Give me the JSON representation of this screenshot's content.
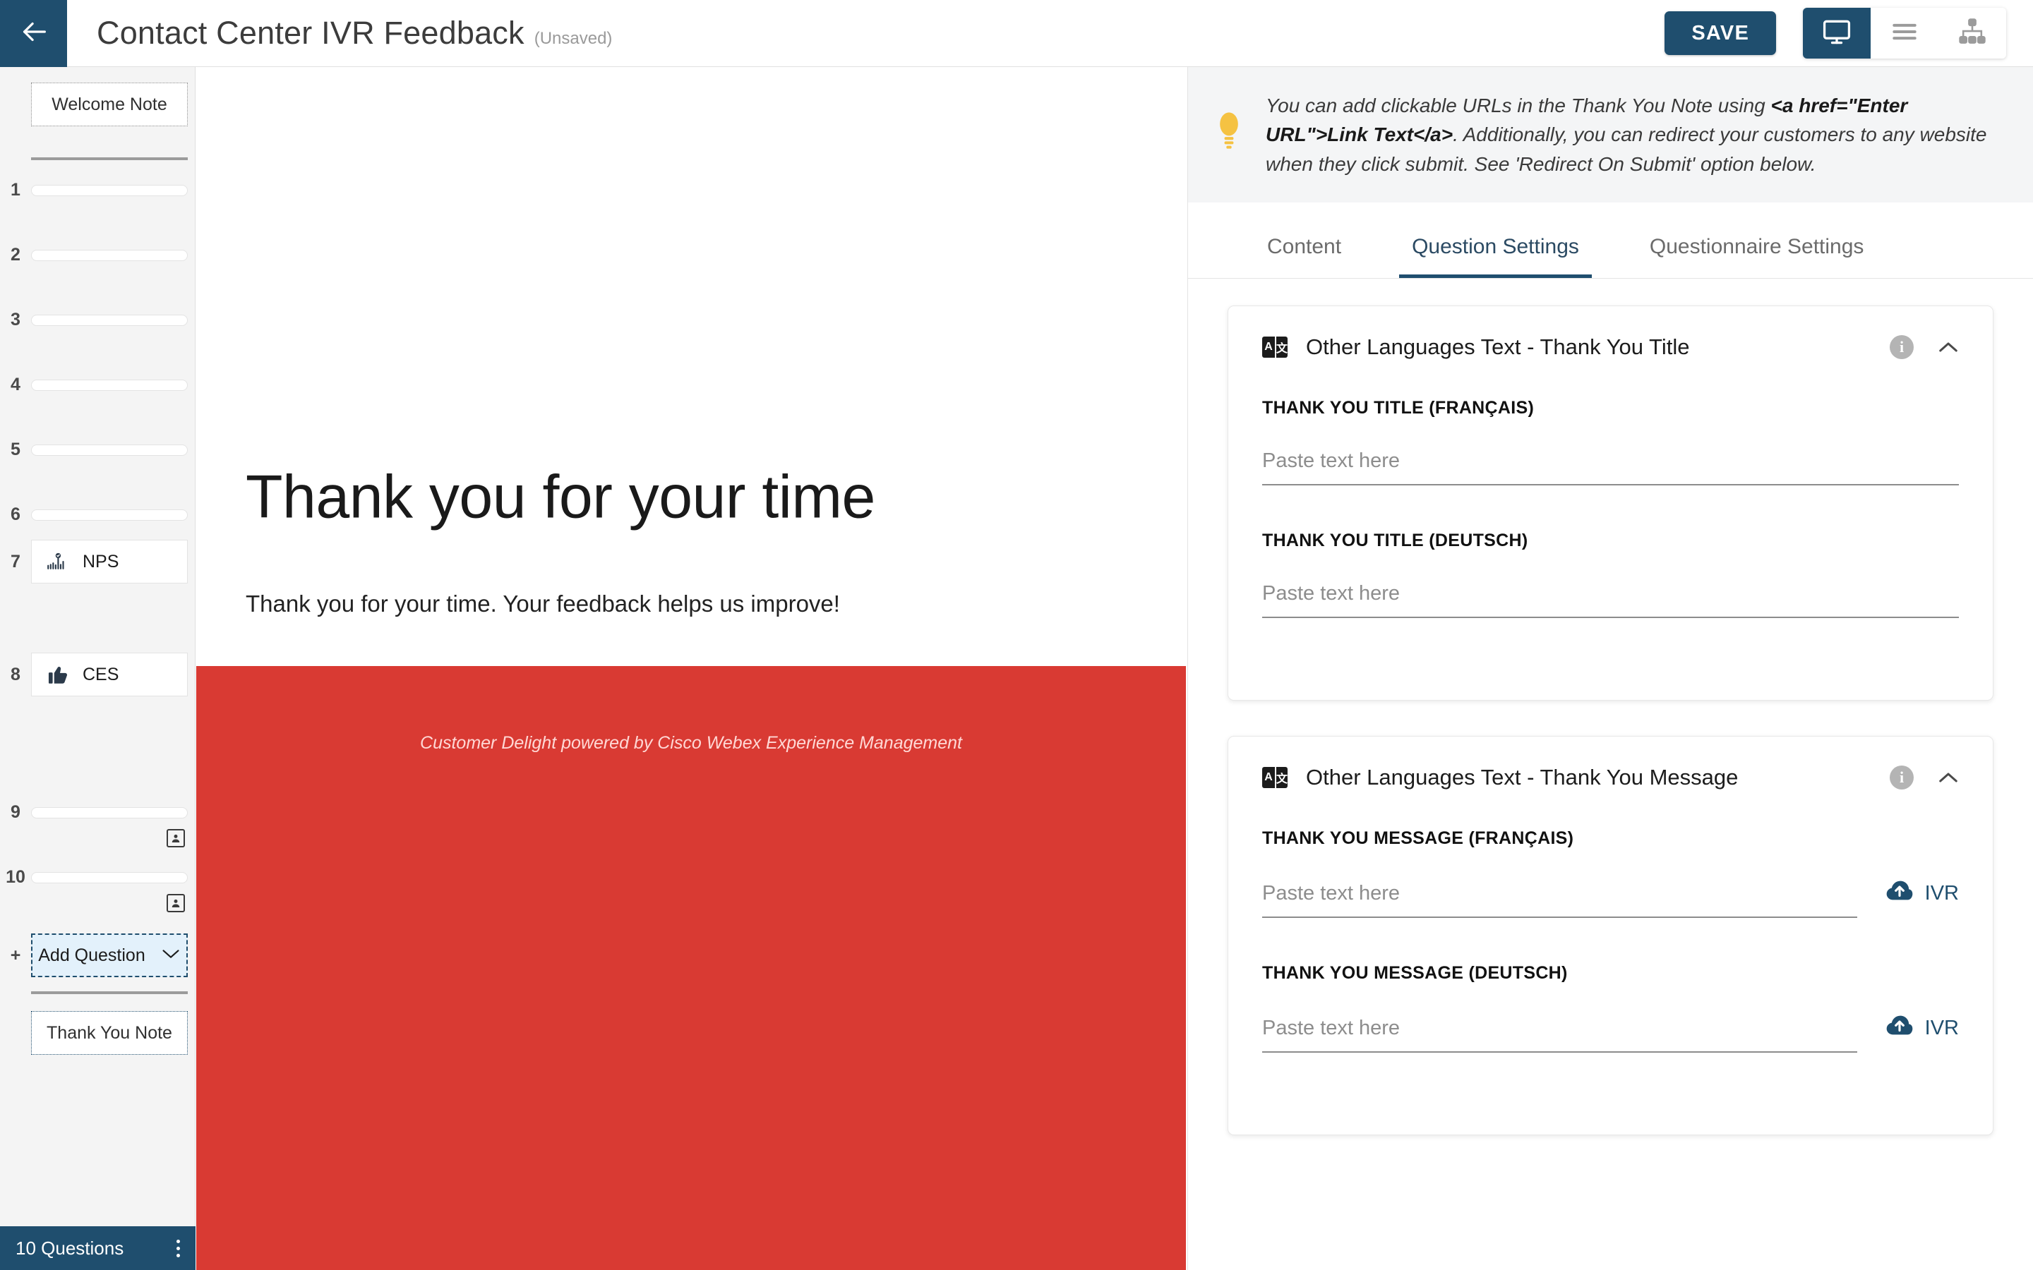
{
  "header": {
    "back_icon": "arrow-left-icon",
    "title": "Contact Center IVR Feedback",
    "unsaved_label": "(Unsaved)",
    "save_label": "SAVE",
    "view_buttons": [
      {
        "name": "preview-desktop",
        "icon": "monitor-icon",
        "active": true
      },
      {
        "name": "list-view",
        "icon": "hamburger-icon",
        "active": false
      },
      {
        "name": "flow-view",
        "icon": "sitemap-icon",
        "active": false
      }
    ]
  },
  "sidebar": {
    "welcome_note_label": "Welcome Note",
    "thank_you_note_label": "Thank You Note",
    "add_question_label": "Add Question",
    "add_question_prefix": "+",
    "questions": [
      {
        "number": "1",
        "type": "bar",
        "label": ""
      },
      {
        "number": "2",
        "type": "bar",
        "label": ""
      },
      {
        "number": "3",
        "type": "bar",
        "label": ""
      },
      {
        "number": "4",
        "type": "bar",
        "label": ""
      },
      {
        "number": "5",
        "type": "bar",
        "label": ""
      },
      {
        "number": "6",
        "type": "bar",
        "label": ""
      },
      {
        "number": "7",
        "type": "card",
        "label": "NPS",
        "icon": "nps-gauge-icon"
      },
      {
        "number": "8",
        "type": "card",
        "label": "CES",
        "icon": "thumbs-up-icon"
      },
      {
        "number": "9",
        "type": "bar",
        "label": "",
        "badge": "contact-card-icon"
      },
      {
        "number": "10",
        "type": "bar",
        "label": "",
        "badge": "contact-card-icon"
      }
    ],
    "status": {
      "count_label": "10 Questions",
      "menu_icon": "vertical-dots-icon"
    }
  },
  "canvas": {
    "thank_you_title": "Thank you for your time",
    "thank_you_message": "Thank you for your time. Your feedback helps us improve!",
    "footer_text": "Customer Delight powered by Cisco Webex Experience Management",
    "footer_color": "#d93a33"
  },
  "right_panel": {
    "tip": {
      "icon": "lightbulb-icon",
      "part1": "You can add clickable URLs in the Thank You Note using ",
      "code": "<a href=\"Enter URL\">Link Text</a>",
      "part2": ". Additionally, you can redirect your customers to any website when they click submit. See 'Redirect On Submit' option below."
    },
    "tabs": [
      {
        "label": "Content",
        "active": false
      },
      {
        "label": "Question Settings",
        "active": true
      },
      {
        "label": "Questionnaire Settings",
        "active": false
      }
    ],
    "cards": [
      {
        "icon": "translate-icon",
        "title": "Other Languages Text - Thank You Title",
        "info_icon": "info-icon",
        "collapse_icon": "chevron-up-icon",
        "fields": [
          {
            "label": "THANK YOU TITLE (FRANÇAIS)",
            "value": "",
            "placeholder": "Paste text here",
            "ivr": false
          },
          {
            "label": "THANK YOU TITLE (DEUTSCH)",
            "value": "",
            "placeholder": "Paste text here",
            "ivr": false
          }
        ]
      },
      {
        "icon": "translate-icon",
        "title": "Other Languages Text - Thank You Message",
        "info_icon": "info-icon",
        "collapse_icon": "chevron-up-icon",
        "fields": [
          {
            "label": "THANK YOU MESSAGE (FRANÇAIS)",
            "value": "",
            "placeholder": "Paste text here",
            "ivr": true,
            "ivr_label": "IVR",
            "ivr_icon": "cloud-upload-icon"
          },
          {
            "label": "THANK YOU MESSAGE (DEUTSCH)",
            "value": "",
            "placeholder": "Paste text here",
            "ivr": true,
            "ivr_label": "IVR",
            "ivr_icon": "cloud-upload-icon"
          }
        ]
      }
    ]
  },
  "colors": {
    "primary": "#1f4e6e",
    "accent_red": "#d93a33",
    "tip_bg": "#f4f5f6"
  }
}
